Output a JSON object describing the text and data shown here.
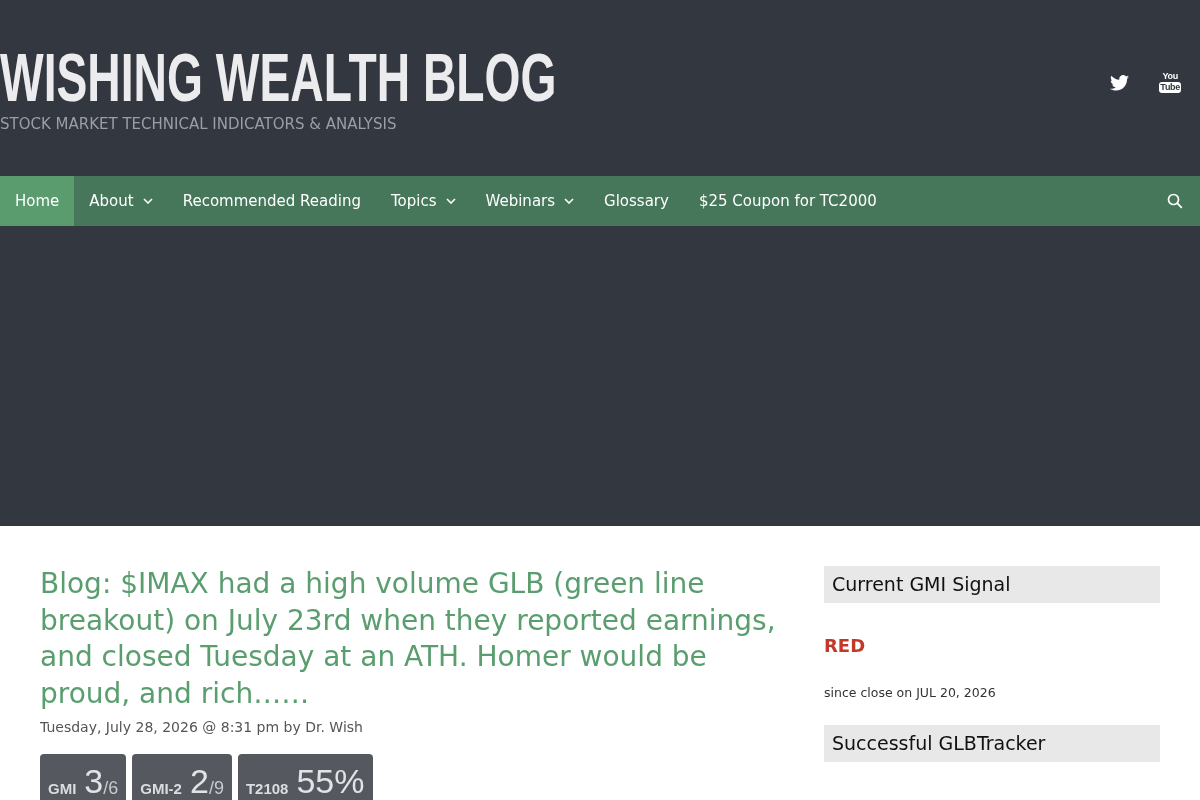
{
  "header": {
    "site_title": "WISHING WEALTH BLOG",
    "tagline": "STOCK MARKET TECHNICAL INDICATORS & ANALYSIS",
    "social": [
      {
        "kind": "bird"
      },
      {
        "kind": "wordmark",
        "top": "You",
        "bottom": "Tube"
      }
    ]
  },
  "nav": {
    "items": [
      {
        "label": "Home",
        "selected": true,
        "dropdown": false
      },
      {
        "label": "About",
        "selected": false,
        "dropdown": true
      },
      {
        "label": "Recommended Reading",
        "selected": false,
        "dropdown": false
      },
      {
        "label": "Topics",
        "selected": false,
        "dropdown": true
      },
      {
        "label": "Webinars",
        "selected": false,
        "dropdown": true
      },
      {
        "label": "Glossary",
        "selected": false,
        "dropdown": false
      },
      {
        "label": "$25 Coupon for TC2000",
        "selected": false,
        "dropdown": false
      }
    ]
  },
  "post": {
    "title": "Blog: $IMAX had a high volume GLB (green line breakout) on July 23rd when they reported earnings, and closed Tuesday at an ATH. Homer would be proud, and rich……",
    "meta": "Tuesday, July 28, 2026 @ 8:31 pm by",
    "author": "Dr. Wish",
    "badges": [
      {
        "label": "GMI",
        "value": "3",
        "total": "/6"
      },
      {
        "label": "GMI-2",
        "value": "2",
        "total": "/9"
      },
      {
        "label": "T2108",
        "value": "55%"
      }
    ]
  },
  "sidebar": {
    "widgets": [
      {
        "title": "Current GMI Signal",
        "signal": {
          "text": "RED",
          "color": "#c0392b"
        },
        "note": "since close on JUL 20, 2026"
      },
      {
        "title": "Successful GLBTracker"
      }
    ]
  }
}
